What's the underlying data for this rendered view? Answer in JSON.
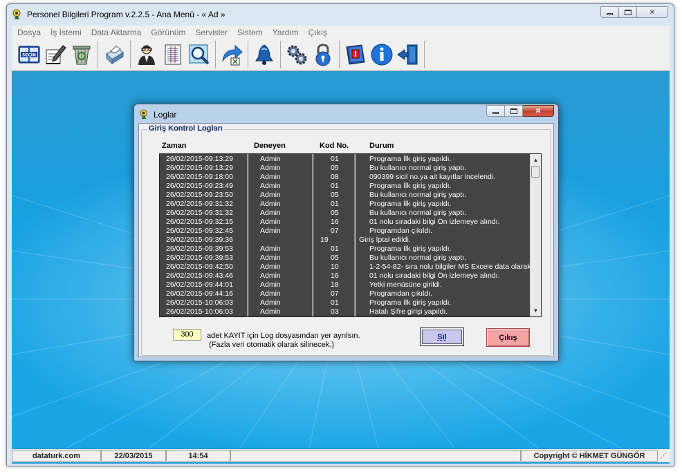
{
  "window": {
    "title": "Personel Bilgileri Program v.2.2.5  - Ana Menü -  « Ad »"
  },
  "menu": [
    "Dosya",
    "İş İstemi",
    "Data Aktarma",
    "Görünüm",
    "Servisler",
    "Sistem",
    "Yardım",
    "Çıkış"
  ],
  "toolbar": {
    "icons": [
      "secin-book-icon",
      "edit-icon",
      "recycle-bin-icon",
      "printer-icon",
      "user-icon",
      "document-icon",
      "search-icon",
      "excel-export-icon",
      "alarm-bell-icon",
      "settings-gears-icon",
      "lock-icon",
      "help-book-icon",
      "info-icon",
      "exit-door-icon"
    ],
    "secin_label": "SEÇİN"
  },
  "statusbar": {
    "site": "dataturk.com",
    "date": "22/03/2015",
    "time": "14:54",
    "copyright": "Copyright © HİKMET GÜNGÖR"
  },
  "dialog": {
    "title": "Loglar",
    "group_title": "Giriş Kontrol Logları",
    "columns": [
      "Zaman",
      "Deneyen",
      "Kod No.",
      "Durum"
    ],
    "rows": [
      {
        "zaman": "26/02/2015-09:13:29",
        "deneyen": "Admin",
        "kod": "01",
        "durum": "Programa İlk giriş yapıldı."
      },
      {
        "zaman": "26/02/2015-09:13:29",
        "deneyen": "Admin",
        "kod": "05",
        "durum": "Bu kullanıcı normal giriş yaptı."
      },
      {
        "zaman": "26/02/2015-09:18:00",
        "deneyen": "Admin",
        "kod": "08",
        "durum": "090399 sicil no.ya ait kayıtlar incelendi."
      },
      {
        "zaman": "26/02/2015-09:23:49",
        "deneyen": "Admin",
        "kod": "01",
        "durum": "Programa İlk giriş yapıldı."
      },
      {
        "zaman": "26/02/2015-09:23:50",
        "deneyen": "Admin",
        "kod": "05",
        "durum": "Bu kullanıcı normal giriş yaptı."
      },
      {
        "zaman": "26/02/2015-09:31:32",
        "deneyen": "Admin",
        "kod": "01",
        "durum": "Programa İlk giriş yapıldı."
      },
      {
        "zaman": "26/02/2015-09:31:32",
        "deneyen": "Admin",
        "kod": "05",
        "durum": "Bu kullanıcı normal giriş yaptı."
      },
      {
        "zaman": "26/02/2015-09:32:15",
        "deneyen": "Admin",
        "kod": "16",
        "durum": "01 nolu sıradaki bilgi Ön izlemeye alındı."
      },
      {
        "zaman": "26/02/2015-09:32:45",
        "deneyen": "Admin",
        "kod": "07",
        "durum": "Programdan çıkıldı."
      },
      {
        "zaman": "26/02/2015-09:39:36",
        "deneyen": "",
        "kod": "19",
        "durum": "Giriş İptal edildi.",
        "shifted": true
      },
      {
        "zaman": "26/02/2015-09:39:53",
        "deneyen": "Admin",
        "kod": "01",
        "durum": "Programa İlk giriş yapıldı."
      },
      {
        "zaman": "26/02/2015-09:39:53",
        "deneyen": "Admin",
        "kod": "05",
        "durum": "Bu kullanıcı normal giriş yaptı."
      },
      {
        "zaman": "26/02/2015-09:42:50",
        "deneyen": "Admin",
        "kod": "10",
        "durum": "1-2-54-82- sıra nolu bilgiler MS Excele data olarak"
      },
      {
        "zaman": "26/02/2015-09:43:46",
        "deneyen": "Admin",
        "kod": "16",
        "durum": "01 nolu sıradaki bilgi Ön izlemeye alındı."
      },
      {
        "zaman": "26/02/2015-09:44:01",
        "deneyen": "Admin",
        "kod": "18",
        "durum": "Yetki menüsüne girildi."
      },
      {
        "zaman": "26/02/2015-09:44:16",
        "deneyen": "Admin",
        "kod": "07",
        "durum": "Programdan çıkıldı."
      },
      {
        "zaman": "26/02/2015-10:06:03",
        "deneyen": "Admin",
        "kod": "01",
        "durum": "Programa İlk giriş yapıldı."
      },
      {
        "zaman": "26/02/2015-10:06:03",
        "deneyen": "Admin",
        "kod": "03",
        "durum": "Hatalı Şifre girişi yapıldı."
      }
    ],
    "record_count": "300",
    "record_text_line1": "adet KAYIT için Log dosyasından yer ayrılsın.",
    "record_text_line2": "(Fazla veri otomatik olarak silinecek.)",
    "delete_label": "Sil",
    "exit_label": "Çıkış"
  }
}
